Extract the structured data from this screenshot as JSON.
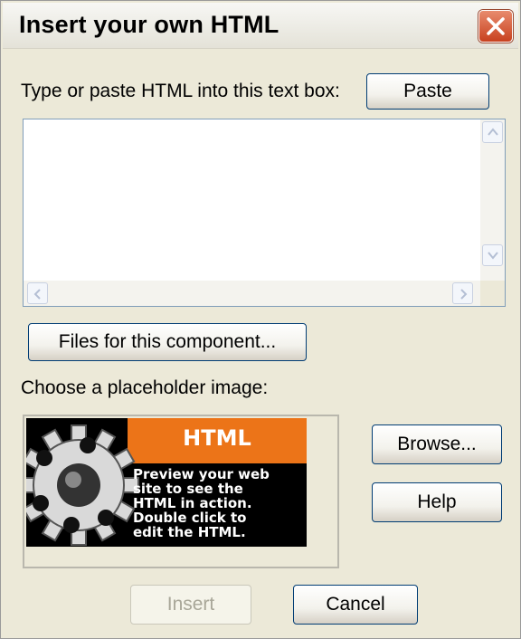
{
  "dialog": {
    "title": "Insert your own HTML",
    "instruction": "Type or paste HTML into this text box:",
    "paste_label": "Paste",
    "html_input_value": "",
    "files_label": "Files for this component...",
    "placeholder_label": "Choose a placeholder image:",
    "browse_label": "Browse...",
    "help_label": "Help",
    "insert_label": "Insert",
    "cancel_label": "Cancel"
  },
  "preview": {
    "heading": "HTML",
    "lines": [
      "Preview your web",
      "site to see the",
      "HTML in action.",
      "Double click to",
      "edit the HTML."
    ]
  },
  "icons": [
    "close-icon",
    "gear-icon",
    "scroll-up-icon",
    "scroll-down-icon",
    "scroll-left-icon",
    "scroll-right-icon"
  ],
  "colors": {
    "dialog_bg": "#ECE9D8",
    "accent_orange": "#EC7418",
    "close_red": "#C8411F",
    "button_border": "#003C74"
  }
}
